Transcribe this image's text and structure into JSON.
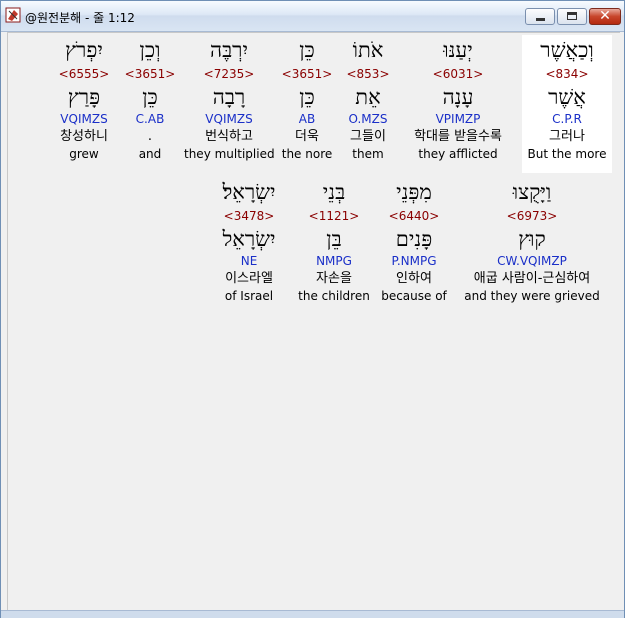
{
  "window": {
    "title": "@원전분해 - 줄 1:12",
    "minimize_label": "",
    "maximize_label": "",
    "close_label": "✕"
  },
  "rows": [
    {
      "words": [
        {
          "hebrew": "וְכַאֲשֶׁר",
          "strong": "<834>",
          "lemma": "אֲשֶׁר",
          "parse": "C.P.R",
          "korean": "그러나",
          "english": "But the more",
          "highlight": true
        },
        {
          "hebrew": "יְעַנּוּ",
          "strong": "<6031>",
          "lemma": "עָנָה",
          "parse": "VPIMZP",
          "korean": "학대를 받을수록",
          "english": "they afflicted"
        },
        {
          "hebrew": "אֹתוֹ",
          "strong": "<853>",
          "lemma": "אֵת",
          "parse": "O.MZS",
          "korean": "그들이",
          "english": "them"
        },
        {
          "hebrew": "כֵּן",
          "strong": "<3651>",
          "lemma": "כֵּן",
          "parse": "AB",
          "korean": "더욱",
          "english": "the nore"
        },
        {
          "hebrew": "יִרְבֶּה",
          "strong": "<7235>",
          "lemma": "רָבָה",
          "parse": "VQIMZS",
          "korean": "번식하고",
          "english": "they multiplied"
        },
        {
          "hebrew": "וְכֵן",
          "strong": "<3651>",
          "lemma": "כֵּן",
          "parse": "C.AB",
          "korean": ".",
          "english": "and"
        },
        {
          "hebrew": "יִפְרֹץ",
          "strong": "<6555>",
          "lemma": "פָּרַץ",
          "parse": "VQIMZS",
          "korean": "창성하니",
          "english": "grew"
        }
      ]
    },
    {
      "words": [
        {
          "hebrew": "וַיָּקֻצוּ",
          "strong": "<6973>",
          "lemma": "קוּץ",
          "parse": "CW.VQIMZP",
          "korean": "애굽 사람이-근심하여",
          "english": "and they were grieved"
        },
        {
          "hebrew": "מִפְּנֵי",
          "strong": "<6440>",
          "lemma": "פָּנִים",
          "parse": "P.NMPG",
          "korean": "인하여",
          "english": "because of"
        },
        {
          "hebrew": "בְּנֵי",
          "strong": "<1121>",
          "lemma": "בֵּן",
          "parse": "NMPG",
          "korean": "자손을",
          "english": "the children"
        },
        {
          "hebrew": "יִשְׂרָאֵל׃",
          "strong": "<3478>",
          "lemma": "יִשְׂרָאֵל",
          "parse": "NE",
          "korean": "이스라엘",
          "english": "of Israel"
        }
      ]
    }
  ]
}
